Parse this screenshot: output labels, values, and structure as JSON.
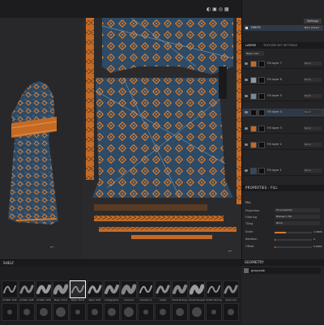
{
  "app": {
    "title": "Substance Painter"
  },
  "viewport3d": {
    "material_dropdown": "Material"
  },
  "texture_set_list": {
    "title": "TEXTURE SET LIST",
    "settings": "Settings",
    "set_name": "DRESS",
    "shader": "Main shader"
  },
  "layers_panel": {
    "tabs": [
      "LAYERS",
      "TEXTURE SET SETTINGS"
    ],
    "channel": "Base color",
    "layers": [
      {
        "name": "Fill layer 7",
        "blend": "Norm"
      },
      {
        "name": "Fill layer 6",
        "blend": "Norm"
      },
      {
        "name": "Fill layer 5",
        "blend": "Norm"
      },
      {
        "name": "Fill layer 4",
        "blend": "Norm"
      },
      {
        "name": "Fill layer 3",
        "blend": "Norm"
      },
      {
        "name": "Fill layer 2",
        "blend": "Norm"
      },
      {
        "name": "Fill layer 1",
        "blend": "Norm"
      }
    ]
  },
  "properties": {
    "title": "PROPERTIES - FILL",
    "section": "FILL",
    "projection_label": "Projection",
    "projection": "UV projection",
    "filtering_label": "Filtering",
    "filtering": "Bilinear | HQ",
    "tiling_label": "Tiling",
    "tiling": "None",
    "scale_label": "Scale",
    "scale": "1.0000",
    "rotation_label": "Rotation",
    "rotation": "0",
    "offset_label": "Offset",
    "offset": "0.0000"
  },
  "shelf": {
    "title": "SHELF",
    "brushes_row1": [
      "Artistic Soft",
      "Artistic Soft",
      "Artistic Soft",
      "Basic Hard",
      "Basic Hard",
      "Basic Soft",
      "Calligraphic",
      "Cement",
      "Cement 2",
      "Chalk",
      "Chalk Bumpy",
      "Chalk Spread",
      "Chalk Strong",
      "Charcoal",
      "Cloth",
      "Crystal"
    ],
    "selected_index": 4
  },
  "graph": {
    "title": "GEOMETRY",
    "entry": "grayscale"
  },
  "colors": {
    "accent": "#d97a2b",
    "fabric": "#2d4a66",
    "fabric_dark": "#233a52"
  }
}
